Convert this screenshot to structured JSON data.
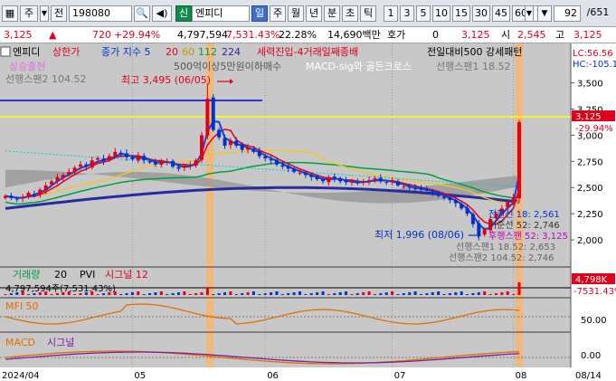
{
  "toolbar": {
    "code": "198080",
    "mode_label": "주",
    "prev_label": "전",
    "credit_label": "신",
    "stock_name": "엔피디",
    "periods": [
      "일",
      "주",
      "월",
      "년",
      "분",
      "초",
      "틱"
    ],
    "active_period": "일",
    "minutes": [
      "1",
      "3",
      "5",
      "10",
      "15",
      "30",
      "45",
      "60",
      "1"
    ],
    "page": "92",
    "page_total": "/651"
  },
  "quote": {
    "price": "3,125",
    "change": "720",
    "change_pct": "+29.94%",
    "volume": "4,797,594",
    "volume_pct": "7,531.43%",
    "turnover": "22.28%",
    "amount": "14,690백만",
    "bid_label": "호가",
    "bid_value": "0",
    "bid_price": "3,125",
    "open_label": "시",
    "open_value": "2,545",
    "high_label": "고",
    "high_value": "3,125"
  },
  "legend": {
    "name": "엔피디",
    "upper_limit": "상한가",
    "sma_label": "종가 지수 5",
    "sma_periods": [
      "20",
      "60",
      "112",
      "224"
    ],
    "pattern1": "세력진입-4거래일째종배",
    "pattern2": "전일대비500 강세패턴",
    "pattern3": "상승출현",
    "pattern4": "500억이상5만원이하매수",
    "pattern5": "MACD-sig와 골든크로스",
    "pattern6": "선행스팬1 18.52",
    "pattern7": "선행스팬2 104.52"
  },
  "side": {
    "lc": "LC:56.56",
    "hc": "HC:-105.1"
  },
  "annotations": {
    "high_text": "최고 3,495 (06/05)",
    "low_text": "최저 1,996 (08/06)",
    "ichimoku": [
      "전환선 18: 2,561",
      "기준선 52: 2,746",
      "후행스팬 52: 3,125",
      "선행스팬1 18.52: 2,653",
      "선행스팬2 104.52: 2,746"
    ],
    "price_tag": "3,125",
    "pct_tag": "29.94%"
  },
  "volume_panel": {
    "label": "거래량",
    "period": "20",
    "pvi": "PVI",
    "signal": "시그널 12",
    "value_text": "4,797,594주(7,531.43%)",
    "tag_value": "4,798K",
    "tag_pct": "7531.43%"
  },
  "mfi_panel": {
    "label": "MFI 50",
    "tick": "50.00"
  },
  "macd_panel": {
    "label": "MACD",
    "signal": "시그널",
    "tick": "0.00"
  },
  "colors": {
    "up": "#e0001b",
    "down": "#0033cc",
    "ma5": "#e0001b",
    "ma20": "#f5c518",
    "ma60": "#00a040",
    "ma224": "#2a2aa0",
    "cloud": "#9a9a9a",
    "chart_bg": "#c8c8c8"
  },
  "chart_data": [
    {
      "type": "candlestick",
      "title": "엔피디",
      "x_labels": [
        "2024/04",
        "05",
        "06",
        "07",
        "08",
        "08/14"
      ],
      "ylim": [
        1750,
        3600
      ],
      "y_ticks": [
        2000,
        2250,
        2500,
        2750,
        3000,
        3250,
        3500
      ],
      "reference_lines": [
        {
          "value": 3125,
          "color": "#ffff00"
        },
        {
          "value": 3290,
          "color": "#0000cc"
        }
      ],
      "highlight_dates": [
        "06/05",
        "08/14"
      ],
      "close_series": [
        2420,
        2400,
        2390,
        2410,
        2450,
        2430,
        2480,
        2520,
        2560,
        2600,
        2620,
        2650,
        2690,
        2720,
        2700,
        2760,
        2780,
        2750,
        2800,
        2840,
        2820,
        2790,
        2770,
        2800,
        2760,
        2740,
        2720,
        2760,
        2750,
        2700,
        2680,
        2710,
        2720,
        2760,
        3000,
        3350,
        3050,
        2980,
        2900,
        2950,
        2900,
        2860,
        2880,
        2840,
        2800,
        2780,
        2760,
        2720,
        2700,
        2680,
        2650,
        2640,
        2620,
        2600,
        2580,
        2560,
        2600,
        2590,
        2560,
        2550,
        2560,
        2540,
        2560,
        2570,
        2590,
        2560,
        2550,
        2560,
        2520,
        2510,
        2500,
        2490,
        2480,
        2470,
        2450,
        2420,
        2400,
        2380,
        2350,
        2300,
        2250,
        2150,
        2050,
        2100,
        2200,
        2250,
        2300,
        2360,
        2405,
        3125
      ],
      "high": 3495,
      "high_date": "06/05",
      "low": 1996,
      "low_date": "08/06",
      "last": 3125
    },
    {
      "type": "bar",
      "title": "거래량",
      "last_value": 4797594
    },
    {
      "type": "line",
      "title": "MFI 50",
      "y_ticks": [
        50
      ]
    },
    {
      "type": "line",
      "title": "MACD",
      "y_ticks": [
        0
      ]
    }
  ]
}
